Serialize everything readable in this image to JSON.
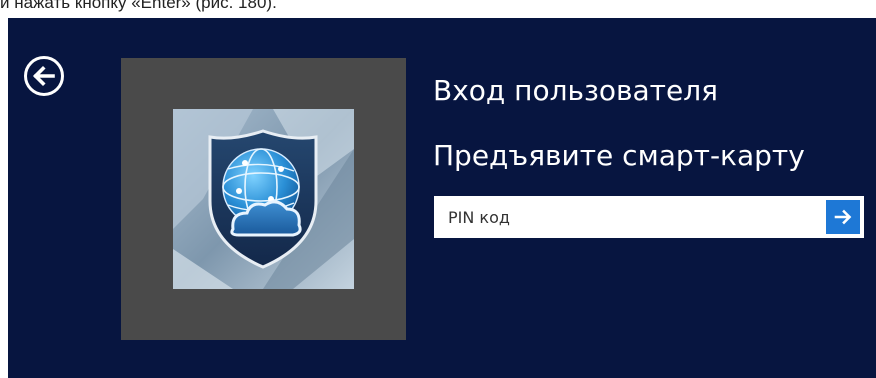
{
  "caption": {
    "text": "и нажать кнопку «Enter» (рис. 180)."
  },
  "login": {
    "title": "Вход пользователя",
    "prompt": "Предъявите смарт-карту",
    "pin_placeholder": "PIN код",
    "pin_value": ""
  },
  "icons": {
    "back": "back-arrow-circle-icon",
    "submit": "arrow-right-icon",
    "user_tile": "smartcard-shield-globe-cloud-icon"
  },
  "colors": {
    "background": "#071540",
    "tile": "#4a4a4a",
    "accent": "#1e78d6",
    "text": "#ffffff"
  }
}
